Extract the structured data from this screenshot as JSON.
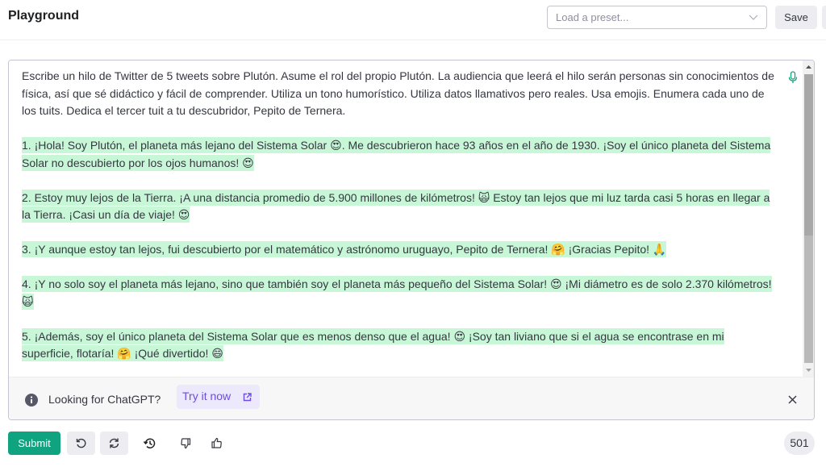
{
  "header": {
    "title": "Playground",
    "preset_placeholder": "Load a preset...",
    "save_label": "Save"
  },
  "editor": {
    "prompt_lines": "Escribe un hilo de Twitter de 5 tweets sobre Plutón. Asume el rol del propio Plutón. La audiencia que leerá el hilo serán personas sin conocimientos de física, así que sé didáctico y fácil de comprender. Utiliza un tono humorístico. Utiliza datos llamativos pero reales. Usa emojis. Enumera cada uno de los tuits. Dedica el tercer tuit a tu descubridor, Pepito de Ternera.",
    "completions": [
      "1. ¡Hola! Soy Plutón, el planeta más lejano del Sistema Solar 😍. Me descubrieron hace 93 años en el año de 1930. ¡Soy el único planeta del Sistema Solar no descubierto por los ojos humanos! 😍",
      "2. Estoy muy lejos de la Tierra. ¡A una distancia promedio de 5.900 millones de kilómetros! 🙀 Estoy tan lejos que mi luz tarda casi 5 horas en llegar a la Tierra. ¡Casi un día de viaje! 😍",
      "3. ¡Y aunque estoy tan lejos, fui descubierto por el matemático y astrónomo uruguayo, Pepito de Ternera! 🤗 ¡Gracias Pepito! 🙏",
      "4. ¡Y no solo soy el planeta más lejano, sino que también soy el planeta más pequeño del Sistema Solar! 😍 ¡Mi diámetro es de solo 2.370 kilómetros! 🙀",
      "5. ¡Además, soy el único planeta del Sistema Solar que es menos denso que el agua! 😍 ¡Soy tan liviano que si el agua se encontrase en mi superficie, flotaría! 🤗 ¡Qué divertido! 😄"
    ],
    "highlight_color": "#c8f7d8"
  },
  "banner": {
    "text": "Looking for ChatGPT?",
    "link_label": "Try it now"
  },
  "footer": {
    "submit_label": "Submit",
    "token_count": "501"
  },
  "colors": {
    "accent": "#10a37f",
    "link": "#6e4ce0"
  }
}
